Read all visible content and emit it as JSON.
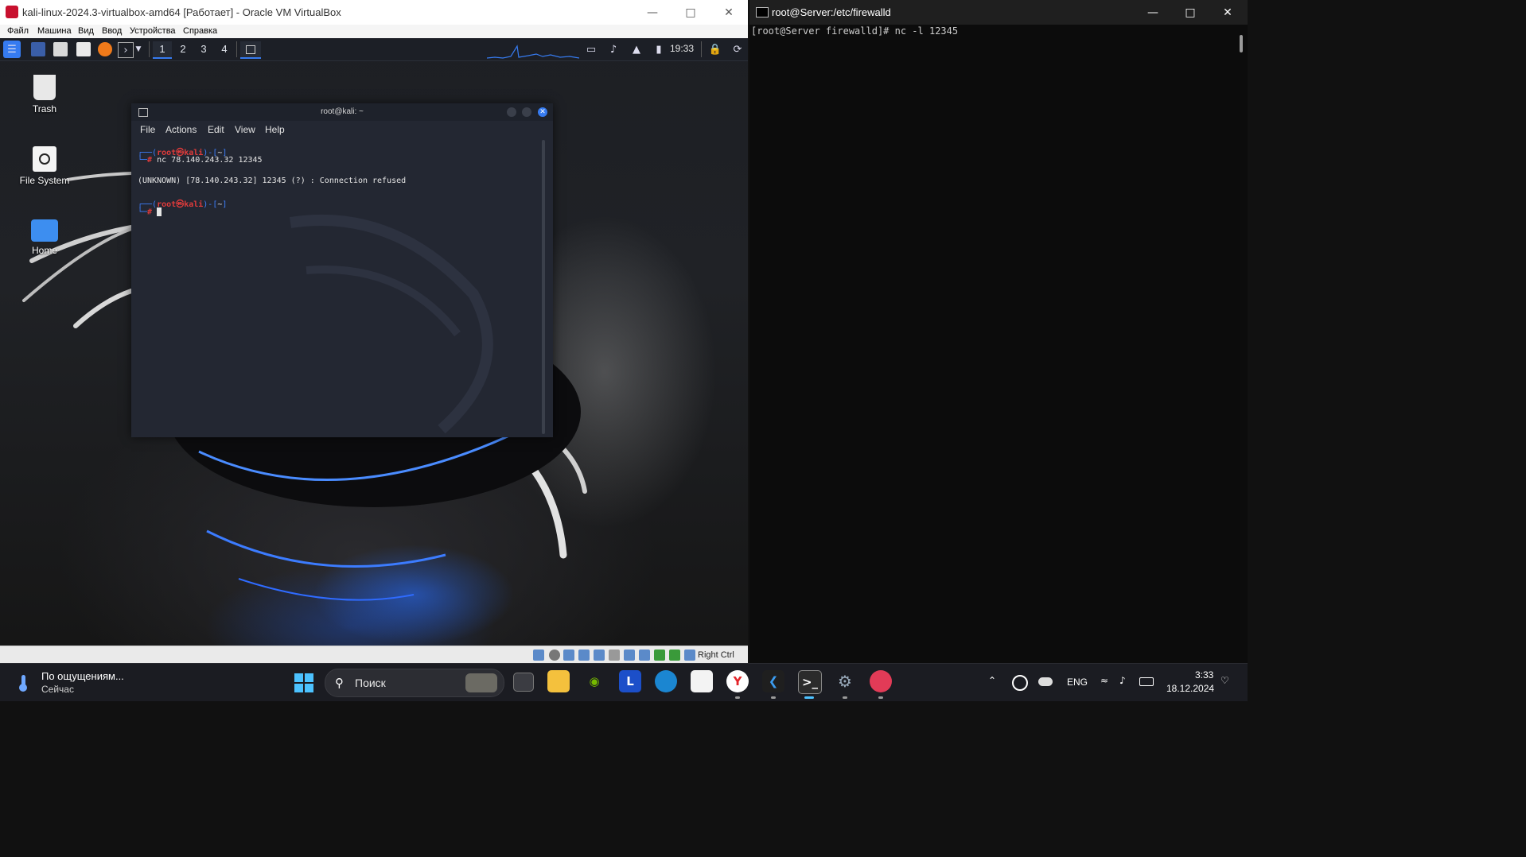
{
  "vbox": {
    "title": "kali-linux-2024.3-virtualbox-amd64 [Работает] - Oracle VM VirtualBox",
    "menu": [
      "Файл",
      "Машина",
      "Вид",
      "Ввод",
      "Устройства",
      "Справка"
    ],
    "host_key": "Right Ctrl"
  },
  "kali": {
    "panel": {
      "workspaces": [
        "1",
        "2",
        "3",
        "4"
      ],
      "active_workspace": "1",
      "clock": "19:33"
    },
    "desktop_icons": [
      {
        "label": "Trash",
        "icon": "trash-icon"
      },
      {
        "label": "File System",
        "icon": "drive-icon"
      },
      {
        "label": "Home",
        "icon": "home-folder-icon"
      }
    ],
    "terminal": {
      "title": "root@kali: ~",
      "menu": [
        "File",
        "Actions",
        "Edit",
        "View",
        "Help"
      ],
      "lines": {
        "prompt1_user": "root",
        "prompt1_at": "㉿",
        "prompt1_host": "kali",
        "prompt1_dir": "~",
        "cmd1": "nc 78.140.243.32 12345",
        "output1": "(UNKNOWN) [78.140.243.32] 12345 (?) : Connection refused",
        "prompt2_user": "root",
        "prompt2_at": "㉿",
        "prompt2_host": "kali",
        "prompt2_dir": "~"
      }
    }
  },
  "host_terminal": {
    "title": "root@Server:/etc/firewalld",
    "line1": "[root@Server firewalld]# nc -l 12345"
  },
  "taskbar": {
    "weather_line1": "По ощущениям...",
    "weather_line2": "Сейчас",
    "search_placeholder": "Поиск",
    "language": "ENG",
    "time": "3:33",
    "date": "18.12.2024",
    "apps": [
      "start-icon",
      "task-view-icon",
      "file-explorer-icon",
      "nvidia-icon",
      "l-app-icon",
      "edge-icon",
      "store-icon",
      "yandex-browser-icon",
      "vscode-icon",
      "terminal-icon",
      "settings-icon",
      "virtualbox-icon"
    ]
  },
  "colors": {
    "kali_blue": "#367bf0",
    "prompt_red": "#e03b3b",
    "taskbar": "#1b1c22",
    "host_terminal_bg": "#0c0c0c"
  }
}
